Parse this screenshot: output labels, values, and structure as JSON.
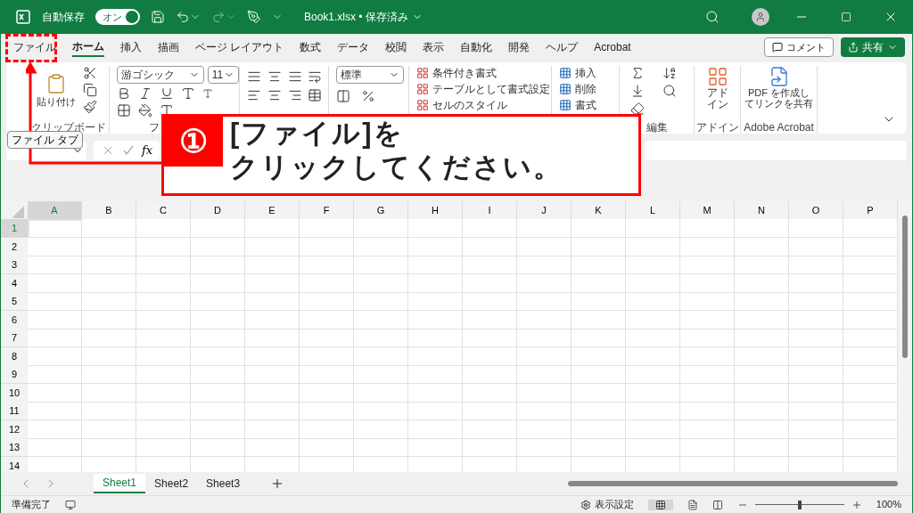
{
  "title_bar": {
    "autosave_label": "自動保存",
    "autosave_toggle": {
      "label": "オン",
      "on": true
    },
    "file_title": "Book1.xlsx • 保存済み"
  },
  "menu_tabs": [
    {
      "label": "ファイル",
      "selected": false
    },
    {
      "label": "ホーム",
      "selected": true
    },
    {
      "label": "挿入",
      "selected": false
    },
    {
      "label": "描画",
      "selected": false
    },
    {
      "label": "ページ レイアウト",
      "selected": false
    },
    {
      "label": "数式",
      "selected": false
    },
    {
      "label": "データ",
      "selected": false
    },
    {
      "label": "校閲",
      "selected": false
    },
    {
      "label": "表示",
      "selected": false
    },
    {
      "label": "自動化",
      "selected": false
    },
    {
      "label": "開発",
      "selected": false
    },
    {
      "label": "ヘルプ",
      "selected": false
    },
    {
      "label": "Acrobat",
      "selected": false
    }
  ],
  "comment_button": "コメント",
  "share_button": "共有",
  "ribbon": {
    "paste_label": "貼り付け",
    "clipboard_label": "クリップボード",
    "font_name": "游ゴシック",
    "font_size": "11",
    "font_label": "フ",
    "number_format": "標準",
    "style_items": [
      "条件付き書式",
      "テーブルとして書式設定",
      "セルのスタイル"
    ],
    "cell_items": [
      "挿入",
      "削除",
      "書式"
    ],
    "editing_label": "編集",
    "addin_button": "アドイン",
    "addin_label": "アドイン",
    "acrobat_button": "PDF を作成してリンクを共有",
    "acrobat_label": "Adobe Acrobat"
  },
  "formula_bar": {
    "tooltip": "ファイル タブ",
    "fx": "fx"
  },
  "sheet": {
    "columns": [
      "A",
      "B",
      "C",
      "D",
      "E",
      "F",
      "G",
      "H",
      "I",
      "J",
      "K",
      "L",
      "M",
      "N",
      "O",
      "P"
    ],
    "rows": [
      "1",
      "2",
      "3",
      "4",
      "5",
      "6",
      "7",
      "8",
      "9",
      "10",
      "11",
      "12",
      "13",
      "14"
    ]
  },
  "sheet_tabs": [
    {
      "label": "Sheet1",
      "selected": true
    },
    {
      "label": "Sheet2",
      "selected": false
    },
    {
      "label": "Sheet3",
      "selected": false
    }
  ],
  "status_bar": {
    "ready": "準備完了",
    "display_settings": "表示設定",
    "level": 0.5,
    "zoom": "100%"
  },
  "callout": {
    "number": "①",
    "line_1": "[ファイル]を",
    "line_2": "クリックしてください。"
  }
}
